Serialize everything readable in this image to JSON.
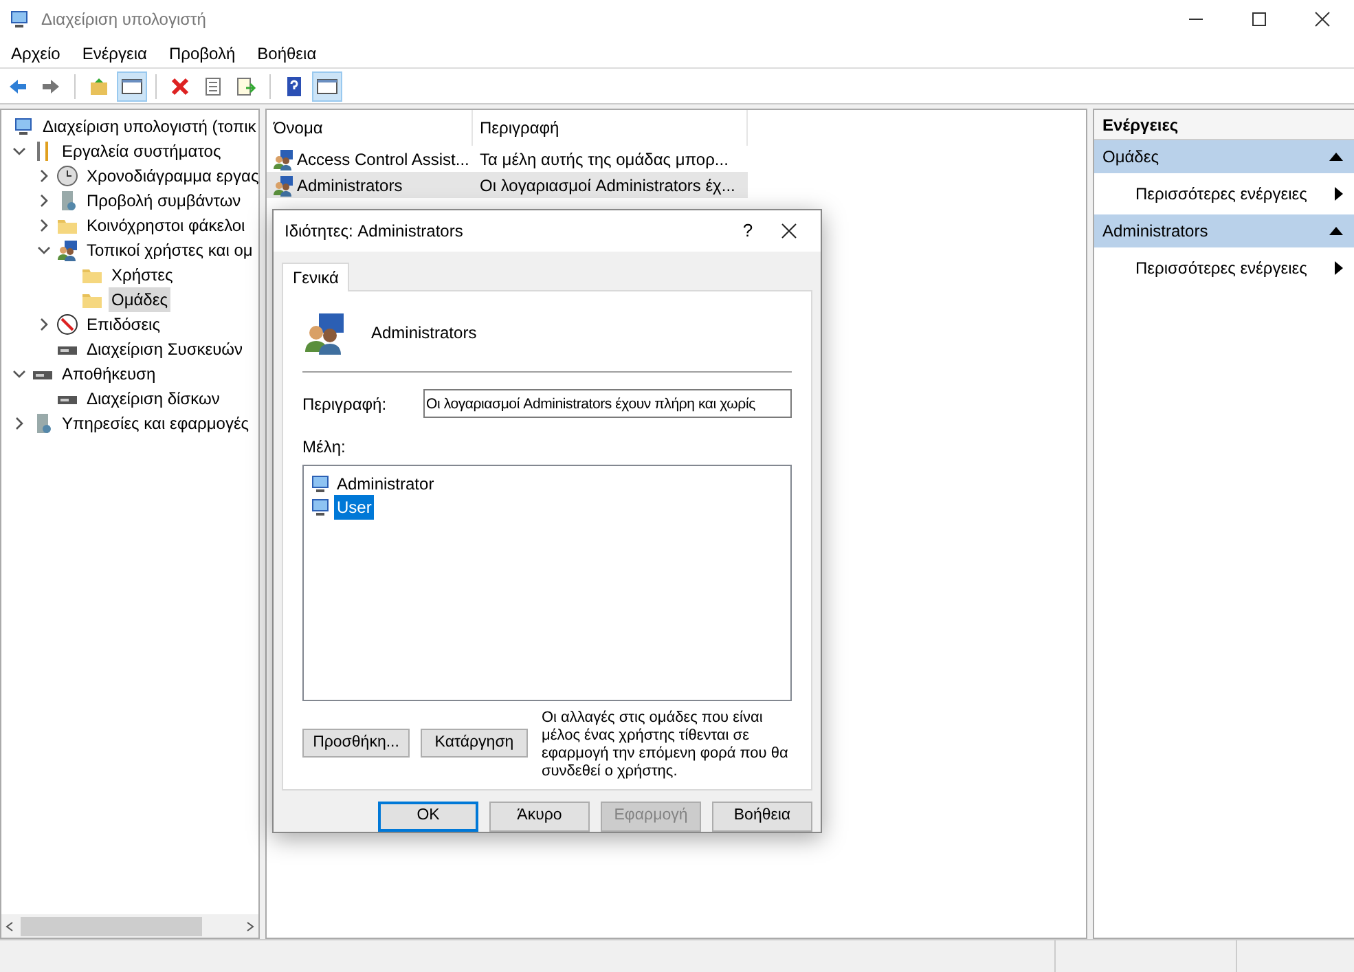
{
  "window": {
    "title": "Διαχείριση υπολογιστή"
  },
  "menu": [
    "Αρχείο",
    "Ενέργεια",
    "Προβολή",
    "Βοήθεια"
  ],
  "tree": [
    {
      "label": "Διαχείριση υπολογιστή (τοπικ",
      "selected": false,
      "children": [
        {
          "label": "Εργαλεία συστήματος",
          "expanded": true,
          "selected": false,
          "children": [
            {
              "label": "Χρονοδιάγραμμα εργας",
              "expanded": false,
              "selected": false
            },
            {
              "label": "Προβολή συμβάντων",
              "expanded": false,
              "selected": false
            },
            {
              "label": "Κοινόχρηστοι φάκελοι",
              "expanded": false,
              "selected": false
            },
            {
              "label": "Τοπικοί χρήστες και ομ",
              "expanded": true,
              "selected": false,
              "children": [
                {
                  "label": "Χρήστες",
                  "selected": false
                },
                {
                  "label": "Ομάδες",
                  "selected": true
                }
              ]
            },
            {
              "label": "Επιδόσεις",
              "expanded": false,
              "selected": false
            },
            {
              "label": "Διαχείριση Συσκευών",
              "selected": false
            }
          ]
        },
        {
          "label": "Αποθήκευση",
          "expanded": true,
          "selected": false,
          "children": [
            {
              "label": "Διαχείριση δίσκων",
              "selected": false
            }
          ]
        },
        {
          "label": "Υπηρεσίες και εφαρμογές",
          "expanded": false,
          "selected": false
        }
      ]
    }
  ],
  "table": {
    "columns": [
      "Όνομα",
      "Περιγραφή"
    ],
    "rows": [
      {
        "name": "Access Control Assist...",
        "description": "Τα μέλη αυτής της ομάδας μπορ...",
        "selected": false
      },
      {
        "name": "Administrators",
        "description": "Οι λογαριασμοί Administrators έχ...",
        "selected": true
      }
    ]
  },
  "actions": {
    "title": "Ενέργειες",
    "sections": [
      {
        "title": "Ομάδες",
        "expanded": true,
        "items": [
          "Περισσότερες ενέργειες"
        ]
      },
      {
        "title": "Administrators",
        "expanded": true,
        "items": [
          "Περισσότερες ενέργειες"
        ]
      }
    ]
  },
  "dialog": {
    "title": "Ιδιότητες: Administrators",
    "help": "?",
    "tabs": [
      {
        "label": "Γενικά",
        "selected": true
      }
    ],
    "group_name": "Administrators",
    "description_label": "Περιγραφή:",
    "description_value": "Οι λογαριασμοί Administrators έχουν πλήρη και χωρίς",
    "members_label": "Μέλη:",
    "members": [
      {
        "name": "Administrator",
        "selected": false
      },
      {
        "name": "User",
        "selected": true
      }
    ],
    "add_button": "Προσθήκη...",
    "remove_button": "Κατάργηση",
    "note": "Οι αλλαγές στις ομάδες που είναι μέλος ένας χρήστης τίθενται σε εφαρμογή την επόμενη φορά που θα συνδεθεί ο χρήστης.",
    "buttons": [
      {
        "label": "OK",
        "default": true,
        "disabled": false
      },
      {
        "label": "Άκυρο",
        "default": false,
        "disabled": false
      },
      {
        "label": "Εφαρμογή",
        "default": false,
        "disabled": true
      },
      {
        "label": "Βοήθεια",
        "default": false,
        "disabled": false
      }
    ]
  }
}
